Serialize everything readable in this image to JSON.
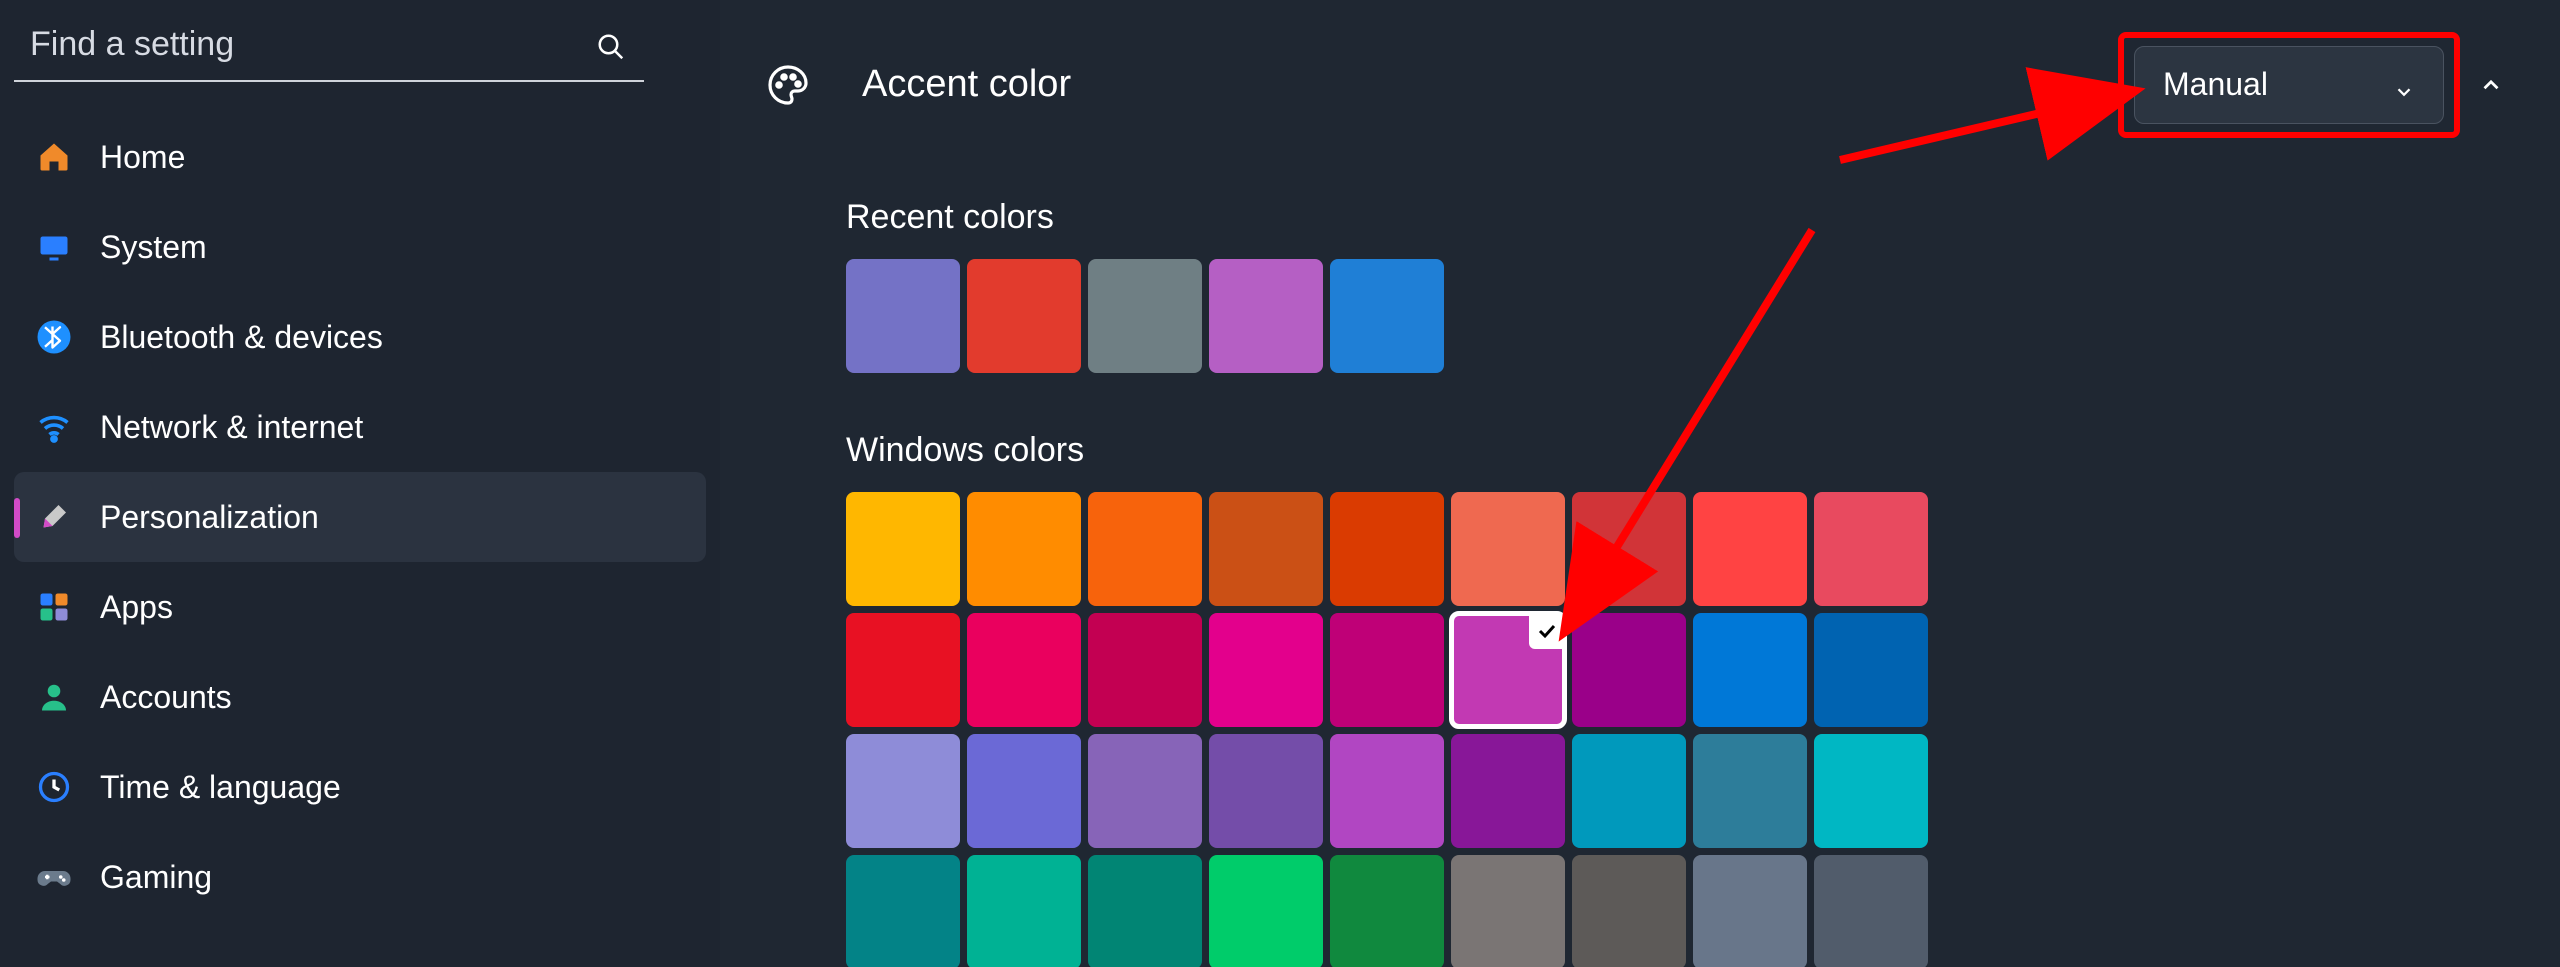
{
  "search": {
    "placeholder": "Find a setting"
  },
  "sidebar": {
    "items": [
      {
        "label": "Home",
        "icon": "home",
        "color1": "#f08a2a",
        "color2": "#3a7bd5"
      },
      {
        "label": "System",
        "icon": "system",
        "color": "#2a7fff"
      },
      {
        "label": "Bluetooth & devices",
        "icon": "bluetooth",
        "color": "#1e90ff"
      },
      {
        "label": "Network & internet",
        "icon": "wifi",
        "color": "#1e90ff"
      },
      {
        "label": "Personalization",
        "icon": "brush",
        "color": "#d24bc7",
        "active": true
      },
      {
        "label": "Apps",
        "icon": "apps",
        "color": "#2a7fff"
      },
      {
        "label": "Accounts",
        "icon": "accounts",
        "color": "#27c08a"
      },
      {
        "label": "Time & language",
        "icon": "time",
        "color": "#2a7fff"
      },
      {
        "label": "Gaming",
        "icon": "gaming",
        "color": "#6b7b8c"
      }
    ]
  },
  "header": {
    "title": "Accent color",
    "dropdown_value": "Manual"
  },
  "recent": {
    "title": "Recent colors",
    "colors": [
      "#7472c6",
      "#e23b2d",
      "#6f7f84",
      "#b55fc4",
      "#1f7fd6"
    ]
  },
  "windows": {
    "title": "Windows colors",
    "rows": [
      [
        "#ffb700",
        "#ff8c00",
        "#f7630c",
        "#cb5015",
        "#da3b01",
        "#ef6950",
        "#d13438",
        "#ff4343",
        "#e84a5f"
      ],
      [
        "#e81123",
        "#ea005e",
        "#c30052",
        "#e3008c",
        "#bf0077",
        "#c239b3",
        "#9a0089",
        "#0078d7",
        "#0063b1"
      ],
      [
        "#8e8cd8",
        "#6b69d6",
        "#8764b8",
        "#744da9",
        "#b146c2",
        "#881798",
        "#0099bc",
        "#2d7d9a",
        "#00b7c3"
      ],
      [
        "#038387",
        "#00b294",
        "#018574",
        "#00cc6a",
        "#10893e",
        "#7a7574",
        "#5d5a58",
        "#68768a",
        "#515c6b"
      ]
    ],
    "selected": {
      "row": 1,
      "col": 5
    }
  }
}
